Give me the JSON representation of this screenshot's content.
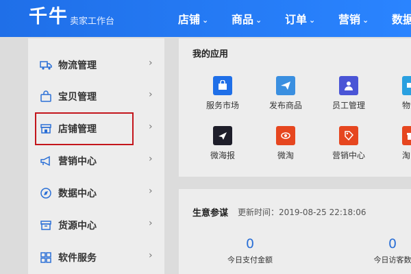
{
  "header": {
    "logo": "千牛",
    "subtitle": "卖家工作台",
    "nav": [
      "店铺",
      "商品",
      "订单",
      "营销",
      "数据"
    ],
    "brand_color": "#1f6fe8"
  },
  "sidebar": {
    "items": [
      {
        "label": "物流管理",
        "icon": "truck-icon"
      },
      {
        "label": "宝贝管理",
        "icon": "shopping-bag-icon"
      },
      {
        "label": "店铺管理",
        "icon": "storefront-icon"
      },
      {
        "label": "营销中心",
        "icon": "megaphone-icon"
      },
      {
        "label": "数据中心",
        "icon": "compass-icon"
      },
      {
        "label": "货源中心",
        "icon": "box-icon"
      },
      {
        "label": "软件服务",
        "icon": "grid-icon"
      }
    ],
    "highlighted": "店铺管理",
    "highlight_color": "#c3151b"
  },
  "apps": {
    "title": "我的应用",
    "items": [
      {
        "label": "服务市场",
        "icon": "shopping-bag-icon",
        "color": "#1f6fe8"
      },
      {
        "label": "发布商品",
        "icon": "paper-plane-icon",
        "color": "#3a8fe0"
      },
      {
        "label": "员工管理",
        "icon": "user-icon",
        "color": "#4a55d6"
      },
      {
        "label": "物流",
        "icon": "truck-icon",
        "color": "#2aa0e0"
      },
      {
        "label": "微海报",
        "icon": "send-icon",
        "color": "#1e1e2a"
      },
      {
        "label": "微淘",
        "icon": "eye-icon",
        "color": "#e6461f"
      },
      {
        "label": "营销中心",
        "icon": "tag-icon",
        "color": "#e6461f"
      },
      {
        "label": "淘",
        "icon": "gift-icon",
        "color": "#e6461f"
      }
    ]
  },
  "business": {
    "title": "生意参谋",
    "updated_label": "更新时间：",
    "updated_time": "2019-08-25 22:18:06",
    "stats": [
      {
        "value": "0",
        "label": "今日支付金额"
      },
      {
        "value": "0",
        "label": "今日访客数"
      }
    ]
  }
}
